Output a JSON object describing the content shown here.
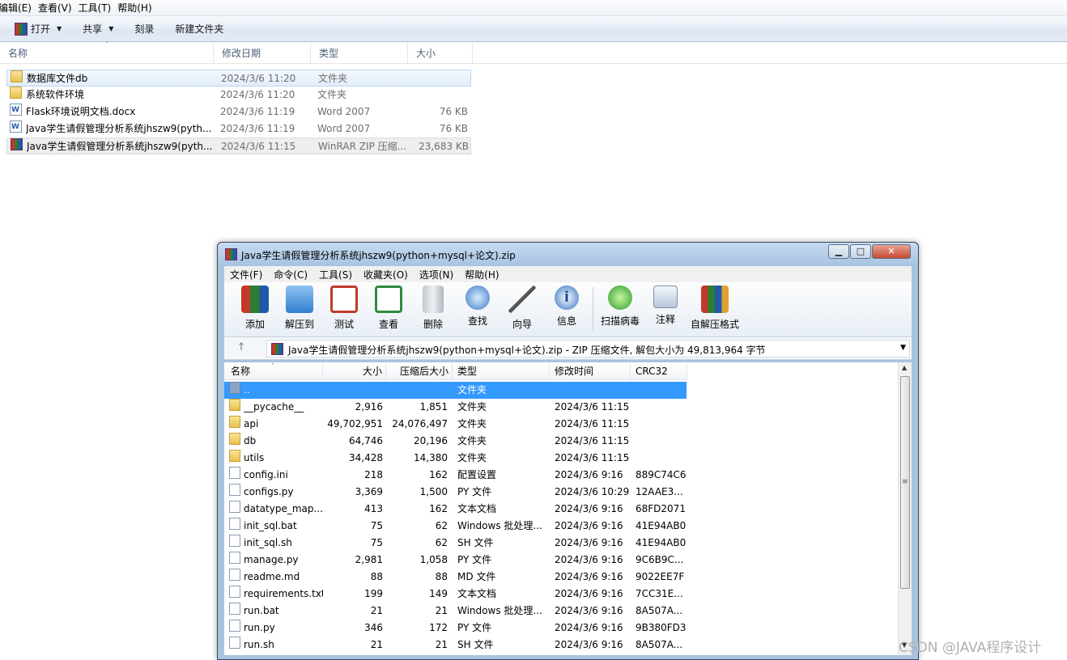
{
  "explorer": {
    "menu": [
      "编辑(E)",
      "查看(V)",
      "工具(T)",
      "帮助(H)"
    ],
    "commands": {
      "open": "打开",
      "share": "共享",
      "burn": "刻录",
      "new_folder": "新建文件夹"
    },
    "columns": {
      "name": "名称",
      "date": "修改日期",
      "type": "类型",
      "size": "大小"
    },
    "rows": [
      {
        "name": "数据库文件db",
        "date": "2024/3/6 11:20",
        "type": "文件夹",
        "size": "",
        "icon": "folder-icon"
      },
      {
        "name": "系统软件环境",
        "date": "2024/3/6 11:20",
        "type": "文件夹",
        "size": "",
        "icon": "folder-icon"
      },
      {
        "name": "Flask环境说明文档.docx",
        "date": "2024/3/6 11:19",
        "type": "Word 2007",
        "size": "76 KB",
        "icon": "word-doc-icon"
      },
      {
        "name": "Java学生请假管理分析系统jhszw9(pyth...",
        "date": "2024/3/6 11:19",
        "type": "Word 2007",
        "size": "76 KB",
        "icon": "word-doc-icon"
      },
      {
        "name": "Java学生请假管理分析系统jhszw9(pyth...",
        "date": "2024/3/6 11:15",
        "type": "WinRAR ZIP 压缩...",
        "size": "23,683 KB",
        "icon": "winrar-archive-icon"
      }
    ]
  },
  "winrar": {
    "title": "Java学生请假管理分析系统jhszw9(python+mysql+论文).zip",
    "window_buttons": {
      "minimize": "▁",
      "maximize": "□",
      "close": "✕"
    },
    "menu": [
      "文件(F)",
      "命令(C)",
      "工具(S)",
      "收藏夹(O)",
      "选项(N)",
      "帮助(H)"
    ],
    "toolbar": [
      "添加",
      "解压到",
      "测试",
      "查看",
      "删除",
      "查找",
      "向导",
      "信息",
      "扫描病毒",
      "注释",
      "自解压格式"
    ],
    "address": "Java学生请假管理分析系统jhszw9(python+mysql+论文).zip - ZIP 压缩文件, 解包大小为 49,813,964 字节",
    "columns": {
      "name": "名称",
      "size": "大小",
      "packed": "压缩后大小",
      "type": "类型",
      "modified": "修改时间",
      "crc": "CRC32"
    },
    "rows": [
      {
        "name": "..",
        "size": "",
        "packed": "",
        "type": "文件夹",
        "modified": "",
        "crc": "",
        "icon": "up-folder-icon"
      },
      {
        "name": "__pycache__",
        "size": "2,916",
        "packed": "1,851",
        "type": "文件夹",
        "modified": "2024/3/6 11:15",
        "crc": "",
        "icon": "folder-icon"
      },
      {
        "name": "api",
        "size": "49,702,951",
        "packed": "24,076,497",
        "type": "文件夹",
        "modified": "2024/3/6 11:15",
        "crc": "",
        "icon": "folder-icon"
      },
      {
        "name": "db",
        "size": "64,746",
        "packed": "20,196",
        "type": "文件夹",
        "modified": "2024/3/6 11:15",
        "crc": "",
        "icon": "folder-icon"
      },
      {
        "name": "utils",
        "size": "34,428",
        "packed": "14,380",
        "type": "文件夹",
        "modified": "2024/3/6 11:15",
        "crc": "",
        "icon": "folder-icon"
      },
      {
        "name": "config.ini",
        "size": "218",
        "packed": "162",
        "type": "配置设置",
        "modified": "2024/3/6 9:16",
        "crc": "889C74C6",
        "icon": "settings-file-icon"
      },
      {
        "name": "configs.py",
        "size": "3,369",
        "packed": "1,500",
        "type": "PY 文件",
        "modified": "2024/3/6 10:29",
        "crc": "12AAE3...",
        "icon": "file-icon"
      },
      {
        "name": "datatype_map....",
        "size": "413",
        "packed": "162",
        "type": "文本文档",
        "modified": "2024/3/6 9:16",
        "crc": "68FD2071",
        "icon": "text-file-icon"
      },
      {
        "name": "init_sql.bat",
        "size": "75",
        "packed": "62",
        "type": "Windows 批处理...",
        "modified": "2024/3/6 9:16",
        "crc": "41E94AB0",
        "icon": "batch-file-icon"
      },
      {
        "name": "init_sql.sh",
        "size": "75",
        "packed": "62",
        "type": "SH 文件",
        "modified": "2024/3/6 9:16",
        "crc": "41E94AB0",
        "icon": "file-icon"
      },
      {
        "name": "manage.py",
        "size": "2,981",
        "packed": "1,058",
        "type": "PY 文件",
        "modified": "2024/3/6 9:16",
        "crc": "9C6B9C...",
        "icon": "file-icon"
      },
      {
        "name": "readme.md",
        "size": "88",
        "packed": "88",
        "type": "MD 文件",
        "modified": "2024/3/6 9:16",
        "crc": "9022EE7F",
        "icon": "file-icon"
      },
      {
        "name": "requirements.txt",
        "size": "199",
        "packed": "149",
        "type": "文本文档",
        "modified": "2024/3/6 9:16",
        "crc": "7CC31E...",
        "icon": "text-file-icon"
      },
      {
        "name": "run.bat",
        "size": "21",
        "packed": "21",
        "type": "Windows 批处理...",
        "modified": "2024/3/6 9:16",
        "crc": "8A507A...",
        "icon": "batch-file-icon"
      },
      {
        "name": "run.py",
        "size": "346",
        "packed": "172",
        "type": "PY 文件",
        "modified": "2024/3/6 9:16",
        "crc": "9B380FD3",
        "icon": "file-icon"
      },
      {
        "name": "run.sh",
        "size": "21",
        "packed": "21",
        "type": "SH 文件",
        "modified": "2024/3/6 9:16",
        "crc": "8A507A...",
        "icon": "file-icon"
      }
    ]
  },
  "watermark": "CSDN @JAVA程序设计"
}
